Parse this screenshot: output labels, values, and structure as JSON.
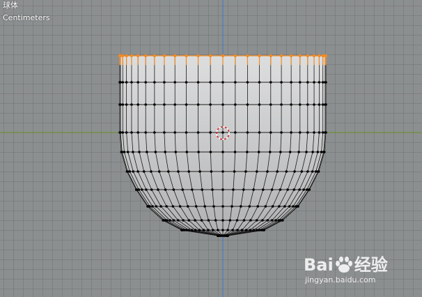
{
  "viewport": {
    "object_name": "球体",
    "units_label": "Centimeters"
  },
  "colors": {
    "axis_x": "#6b9a2a",
    "axis_z": "#3b78c8",
    "mesh_fill": "#d6d7d8",
    "mesh_edge": "#1a1a1a",
    "selected_edge": "#f08a24",
    "background": "#8c8f90"
  },
  "watermark": {
    "brand_left": "Bai",
    "brand_right": "经验",
    "url": "jingyan.baidu.com"
  },
  "icons": {
    "cursor": "3d-cursor-icon",
    "logo": "baidu-paw-icon"
  }
}
